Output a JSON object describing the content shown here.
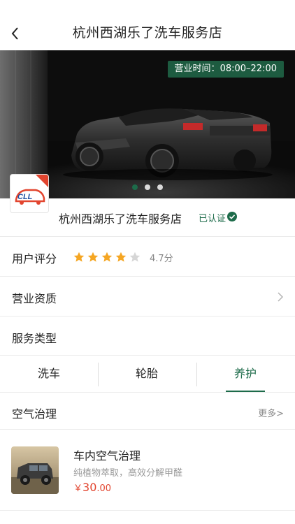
{
  "header": {
    "title": "杭州西湖乐了洗车服务店",
    "back_icon": "chevron-left-icon"
  },
  "banner": {
    "hours_label": "营业时间：",
    "hours_value": "08:00–22:00",
    "slide_count": 3,
    "active_slide": 1
  },
  "logo": {
    "text": "乐了",
    "badge": "车服务"
  },
  "store": {
    "name": "杭州西湖乐了洗车服务店",
    "verified_label": "已认证",
    "verified_icon": "check-circle-icon"
  },
  "rating": {
    "label": "用户评分",
    "stars": 4,
    "max_stars": 5,
    "score_text": "4.7分",
    "star_color": "#f5a623",
    "star_empty_color": "#d6d6d6"
  },
  "license": {
    "label": "营业资质",
    "chevron_icon": "chevron-right-icon"
  },
  "service_types": {
    "label": "服务类型",
    "tabs": [
      {
        "label": "洗车",
        "active": false
      },
      {
        "label": "轮胎",
        "active": false
      },
      {
        "label": "养护",
        "active": true
      }
    ]
  },
  "section": {
    "title": "空气治理",
    "more": "更多>"
  },
  "items": [
    {
      "title": "车内空气治理",
      "desc": "纯植物萃取，高效分解甲醛",
      "price_currency": "￥",
      "price_int": "30",
      "price_dec": ".00"
    }
  ],
  "colors": {
    "accent": "#1d6b4a",
    "price": "#e2452f",
    "hours_bg": "#1d5b40"
  }
}
